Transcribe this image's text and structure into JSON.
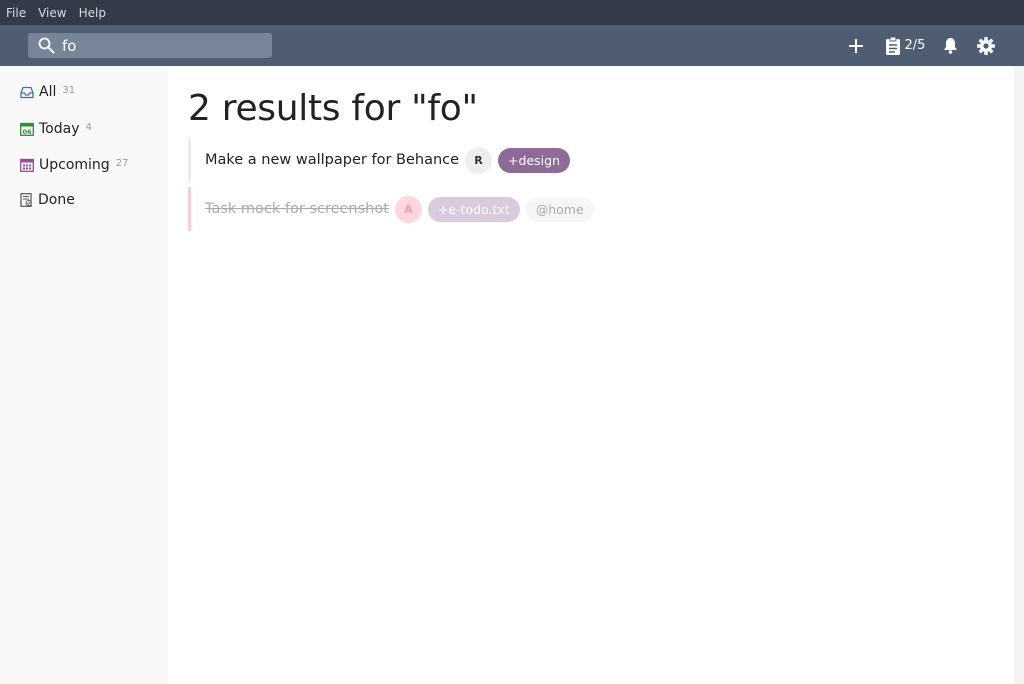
{
  "menu": {
    "file": "File",
    "view": "View",
    "help": "Help"
  },
  "search": {
    "value": "fo"
  },
  "header": {
    "counter": "2/5"
  },
  "sidebar": {
    "items": [
      {
        "label": "All",
        "count": "31"
      },
      {
        "label": "Today",
        "count": "4"
      },
      {
        "label": "Upcoming",
        "count": "27"
      },
      {
        "label": "Done",
        "count": ""
      }
    ]
  },
  "main": {
    "title": "2 results for \"fo\"",
    "todos": [
      {
        "text": "Make a new wallpaper for Behance",
        "priority": "R",
        "project": "+design"
      },
      {
        "text": "Task mock for screenshot",
        "priority": "A",
        "project": "+e-todo.txt",
        "context": "@home"
      }
    ]
  },
  "colors": {
    "menubar": "#333a48",
    "header": "#4e5d72",
    "search_bg": "#778598",
    "project_tag": "#8e6a98",
    "today_icon": "#2f8a3a",
    "upcoming_icon": "#9a4a9a",
    "all_icon": "#3b6fc9"
  }
}
